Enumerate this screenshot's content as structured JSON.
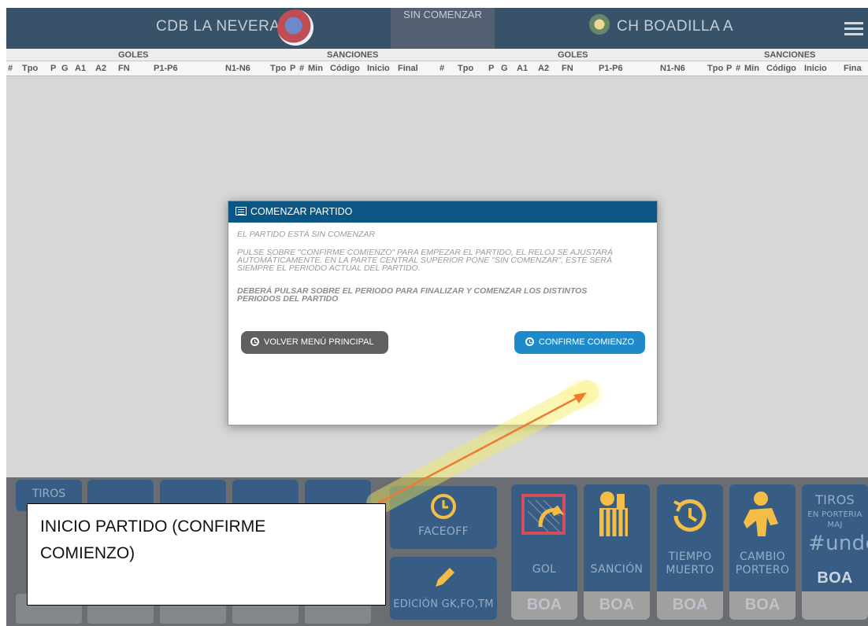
{
  "header": {
    "home_team": "CDB LA NEVERA",
    "away_team": "CH BOADILLA A",
    "period": "SIN COMENZAR"
  },
  "table": {
    "groups": [
      "GOLES",
      "SANCIONES",
      "GOLES",
      "SANCIONES"
    ],
    "columns_left": [
      "#",
      "Tpo",
      "P",
      "G",
      "A1",
      "A2",
      "FN",
      "P1-P6",
      "N1-N6",
      "Tpo",
      "P",
      "#",
      "Min",
      "Código",
      "Inicio",
      "Final"
    ],
    "columns_right": [
      "#",
      "Tpo",
      "P",
      "G",
      "A1",
      "A2",
      "FN",
      "P1-P6",
      "N1-N6",
      "Tpo",
      "P",
      "#",
      "Min",
      "Código",
      "Inicio",
      "Fina"
    ]
  },
  "dock": {
    "left_tiros": "TIROS",
    "faceoff": "FACEOFF",
    "edicion": "EDICIÓN GK,FO,TM",
    "gol": "GOL",
    "sancion": "SANCIÓN",
    "tiempo_muerto": "TIEMPO MUERTO",
    "cambio_portero": "CAMBIO PORTERO",
    "tiros": "TIROS",
    "en_porteria": "EN PORTERIA",
    "maj": "MAJ",
    "undef": "#unde",
    "team_code": "BOA"
  },
  "modal": {
    "title": "COMENZAR PARTIDO",
    "line1": "EL PARTIDO ESTÁ SIN COMENZAR",
    "line2": "PULSE SOBRE \"CONFIRME COMIENZO\" PARA EMPEZAR EL PARTIDO, EL RELOJ SE AJUSTARÁ AUTOMÁTICAMENTE. EN LA PARTE CENTRAL SUPERIOR PONE \"SIN COMENZAR\", ESTE SERÁ SIEMPRE EL PERIODO ACTUAL DEL PARTIDO.",
    "line3": "DEBERÁ PULSAR SOBRE EL PERIODO PARA FINALIZAR Y COMENZAR LOS DISTINTOS PERIODOS DEL PARTIDO",
    "back_label": "VOLVER MENÚ PRINCIPAL",
    "confirm_label": "CONFIRME COMIENZO"
  },
  "annotation": {
    "line1": "INICIO PARTIDO (CONFIRME",
    "line2": "COMIENZO)"
  }
}
